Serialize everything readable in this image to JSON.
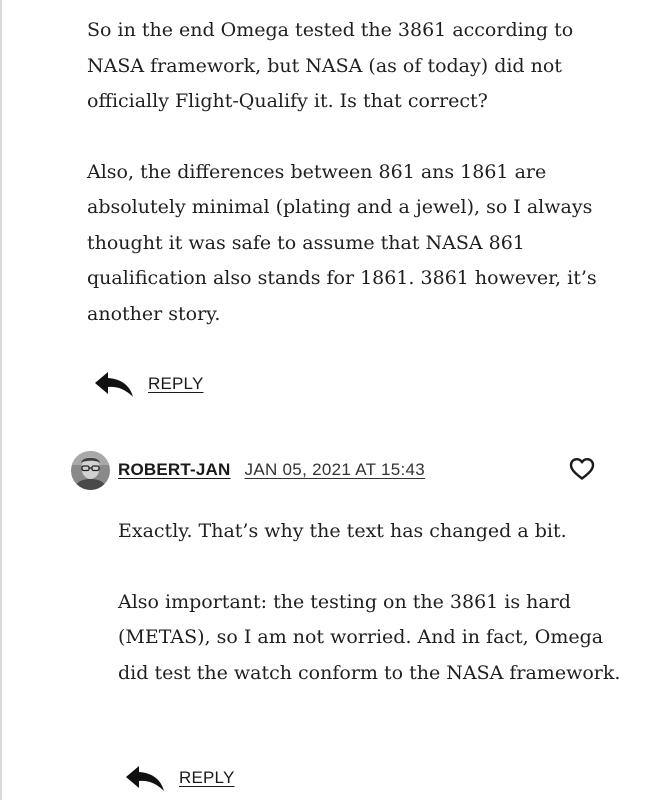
{
  "comments": [
    {
      "paragraphs": [
        "So in the end Omega tested the 3861 according to NASA framework, but NASA (as of today) did not officially Flight-Qualify it. Is that correct?",
        "Also, the differences between 861 ans 1861 are absolutely minimal (plating and a jewel), so I always thought it was safe to assume that NASA 861 qualification also stands for 1861. 3861 however, it’s another story."
      ],
      "reply_label": "REPLY"
    },
    {
      "author": "ROBERT-JAN",
      "timestamp": "JAN 05, 2021 AT 15:43",
      "paragraphs": [
        "Exactly. That’s why the text has changed a bit.",
        "Also important: the testing on the 3861 is hard (METAS), so I am not worried. And in fact, Omega did test the watch conform to the NASA framework."
      ],
      "reply_label": "REPLY"
    }
  ],
  "icons": {
    "reply": "reply-arrow-icon",
    "like": "heart-icon"
  }
}
